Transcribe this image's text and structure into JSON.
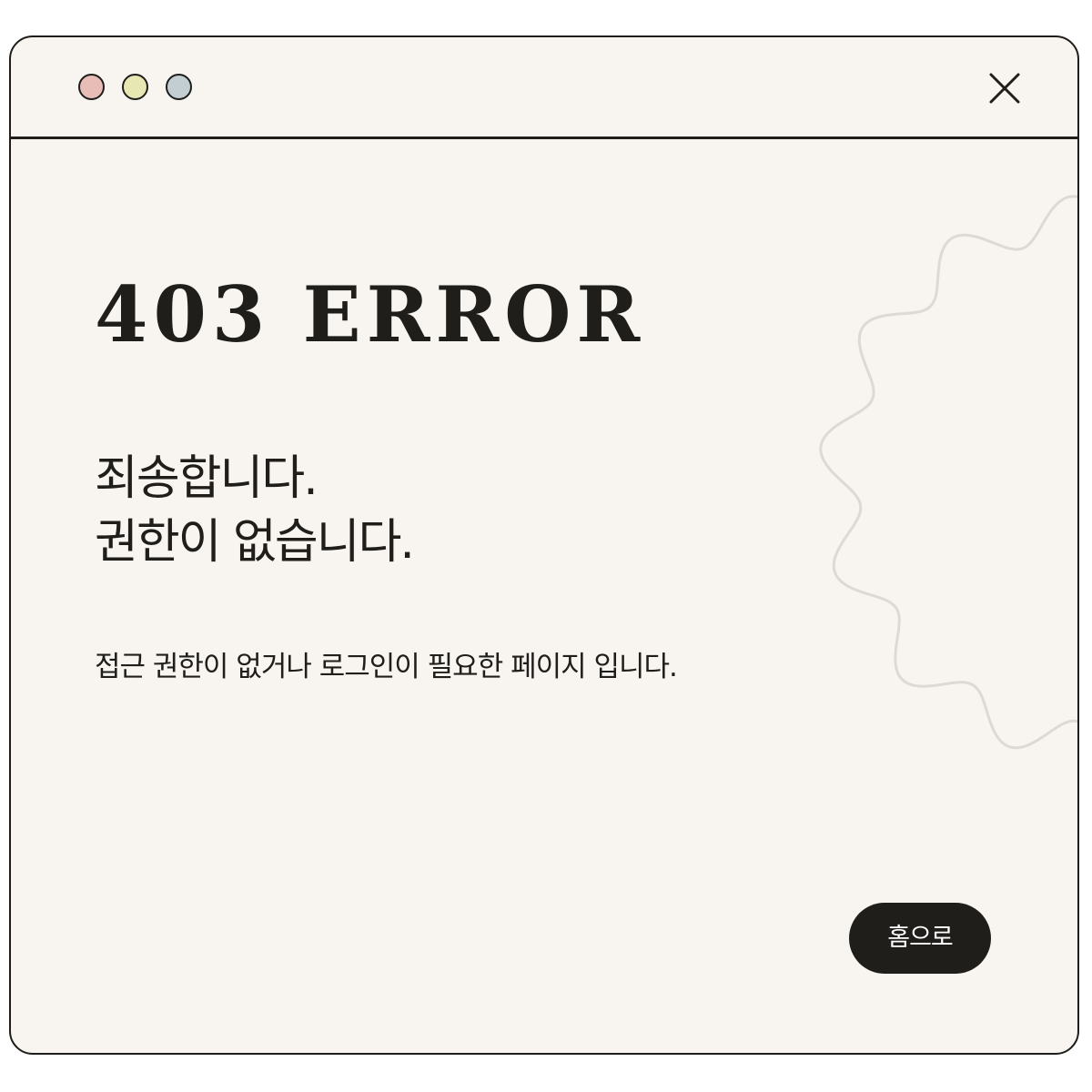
{
  "window": {
    "dots": [
      {
        "name": "red",
        "color": "#e8bdb7"
      },
      {
        "name": "yellow",
        "color": "#e6e7b3"
      },
      {
        "name": "blue",
        "color": "#c2ced2"
      }
    ],
    "close_icon": "close-icon"
  },
  "content": {
    "error_code": "403 ERROR",
    "headline": [
      "죄송합니다.",
      "권한이 없습니다."
    ],
    "description": "접근 권한이 없거나 로그인이 필요한 페이지 입니다.",
    "home_button": "홈으로"
  },
  "colors": {
    "background": "#f8f5f1",
    "border": "#1f1e1b",
    "button": "#1f1e1b",
    "decoration": "#dcdad6"
  },
  "decoration_icon": "wavy-gear-outline"
}
